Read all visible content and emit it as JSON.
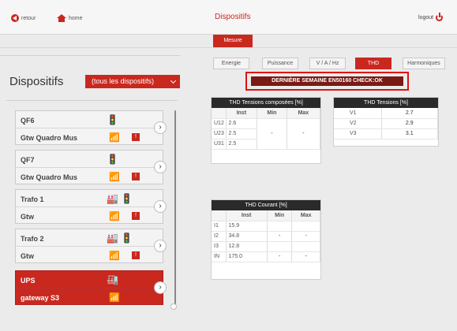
{
  "header": {
    "back_label": "retour",
    "home_label": "home",
    "title": "Dispositifs",
    "logout_label": "logout",
    "mesure_label": "Mesure"
  },
  "sidebar": {
    "title": "Dispositifs",
    "filter_value": "(tous les dispositifs)",
    "devices": [
      {
        "name": "QF6",
        "gateway": "Gtw Quadro Mus",
        "alert": "!"
      },
      {
        "name": "QF7",
        "gateway": "Gtw Quadro Mus",
        "alert": "!"
      },
      {
        "name": "Trafo 1",
        "gateway": "Gtw",
        "alert": "!"
      },
      {
        "name": "Trafo 2",
        "gateway": "Gtw",
        "alert": "!"
      },
      {
        "name": "UPS",
        "gateway": "gateway S3",
        "alert": ""
      }
    ]
  },
  "tabs": [
    "Energie",
    "Puissance",
    "V / A / Hz",
    "THD",
    "Harmoniques"
  ],
  "check_banner": "DERNIÈRE SEMAINE EN50160 CHECK:OK",
  "thd_composees": {
    "title": "THD Tensions composées [%]",
    "headers": [
      "Inst",
      "Min",
      "Max"
    ],
    "rows": [
      {
        "label": "U12",
        "inst": "2.6"
      },
      {
        "label": "U23",
        "inst": "2.5"
      },
      {
        "label": "U31",
        "inst": "2.5"
      }
    ],
    "min": "-",
    "max": "-"
  },
  "thd_tensions": {
    "title": "THD Tensions [%]",
    "rows": [
      {
        "label": "V1",
        "value": "2.7"
      },
      {
        "label": "V2",
        "value": "2.9"
      },
      {
        "label": "V3",
        "value": "3.1"
      }
    ]
  },
  "thd_courant": {
    "title": "THD Courant [%]",
    "headers": [
      "Inst",
      "Min",
      "Max"
    ],
    "rows": [
      {
        "label": "I1",
        "inst": "15.9",
        "min": "",
        "max": ""
      },
      {
        "label": "I2",
        "inst": "34.8",
        "min": "-",
        "max": "-"
      },
      {
        "label": "I3",
        "inst": "12.8",
        "min": "",
        "max": ""
      },
      {
        "label": "IN",
        "inst": "175.0",
        "min": "-",
        "max": "-"
      }
    ]
  },
  "colors": {
    "accent": "#c9281f",
    "banner": "#7a1a14",
    "highlight_border": "#e01010"
  }
}
